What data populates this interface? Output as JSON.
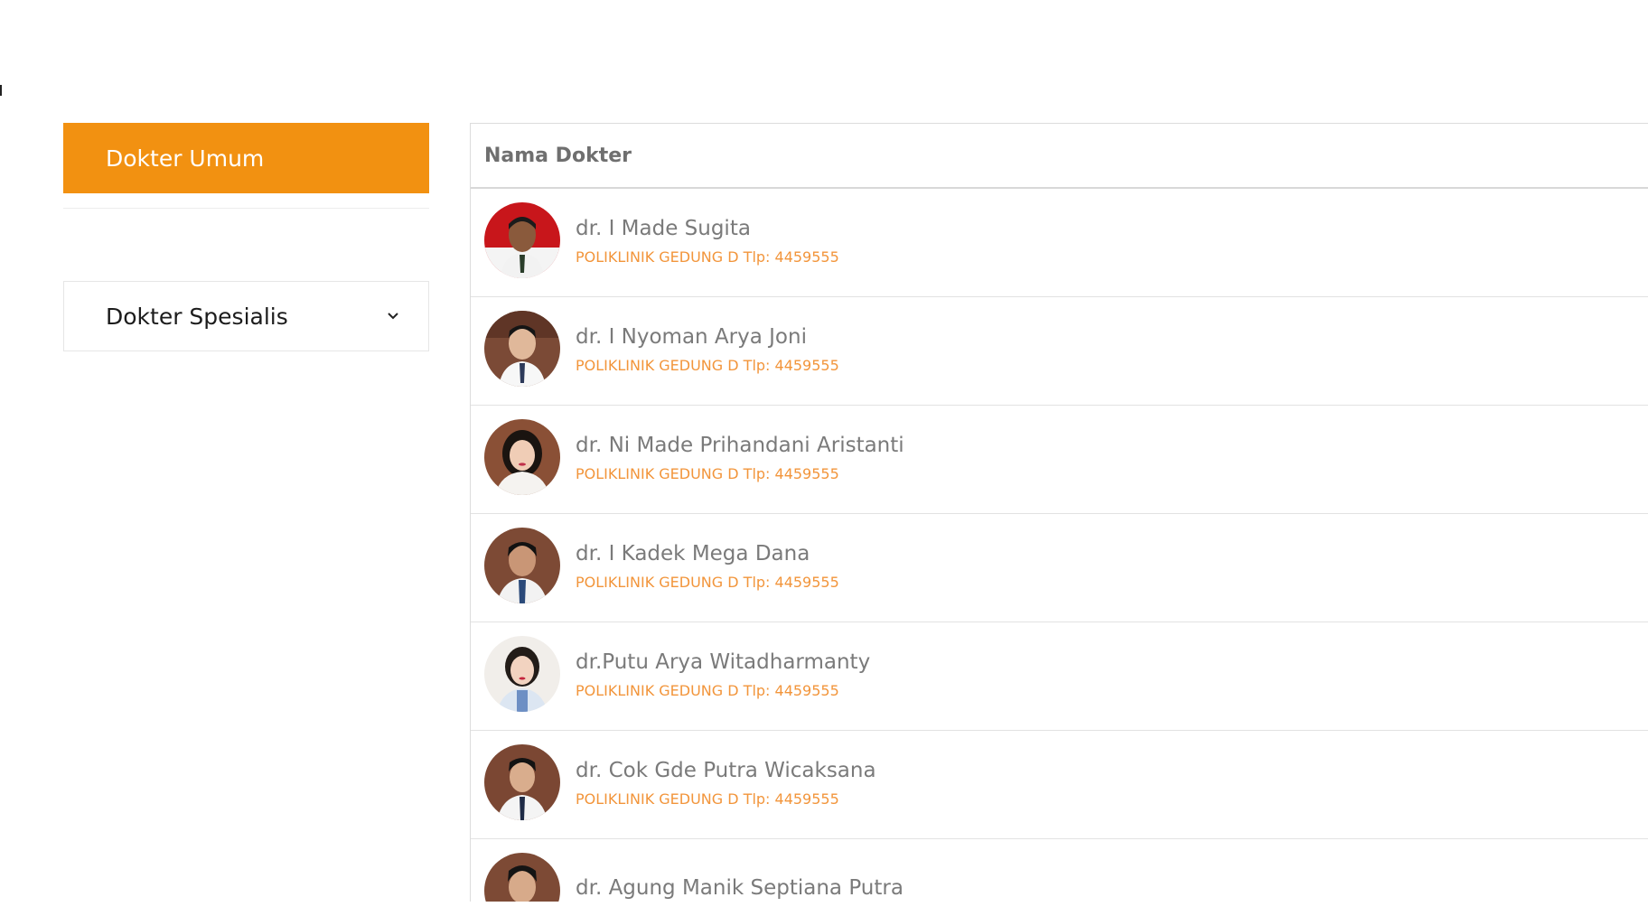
{
  "sidebar": {
    "tabs": [
      {
        "label": "Dokter Umum",
        "active": true
      },
      {
        "label": "Dokter Spesialis",
        "active": false,
        "icon": "chevron-down-icon"
      }
    ]
  },
  "table": {
    "header": "Nama Dokter",
    "rows": [
      {
        "name": "dr. I Made Sugita",
        "location": "POLIKLINIK GEDUNG D Tlp: 4459555"
      },
      {
        "name": "dr. I Nyoman Arya Joni",
        "location": "POLIKLINIK GEDUNG D Tlp: 4459555"
      },
      {
        "name": "dr. Ni Made Prihandani Aristanti",
        "location": "POLIKLINIK GEDUNG D Tlp: 4459555"
      },
      {
        "name": "dr. I Kadek Mega Dana",
        "location": "POLIKLINIK GEDUNG D Tlp: 4459555"
      },
      {
        "name": "dr.Putu Arya Witadharmanty",
        "location": "POLIKLINIK GEDUNG D Tlp: 4459555"
      },
      {
        "name": "dr. Cok Gde Putra Wicaksana",
        "location": "POLIKLINIK GEDUNG D Tlp: 4459555"
      },
      {
        "name": "dr. Agung Manik Septiana Putra",
        "location": ""
      }
    ]
  },
  "colors": {
    "accent": "#f29111",
    "location_text": "#f2953b",
    "name_text": "#7a7a7a"
  }
}
